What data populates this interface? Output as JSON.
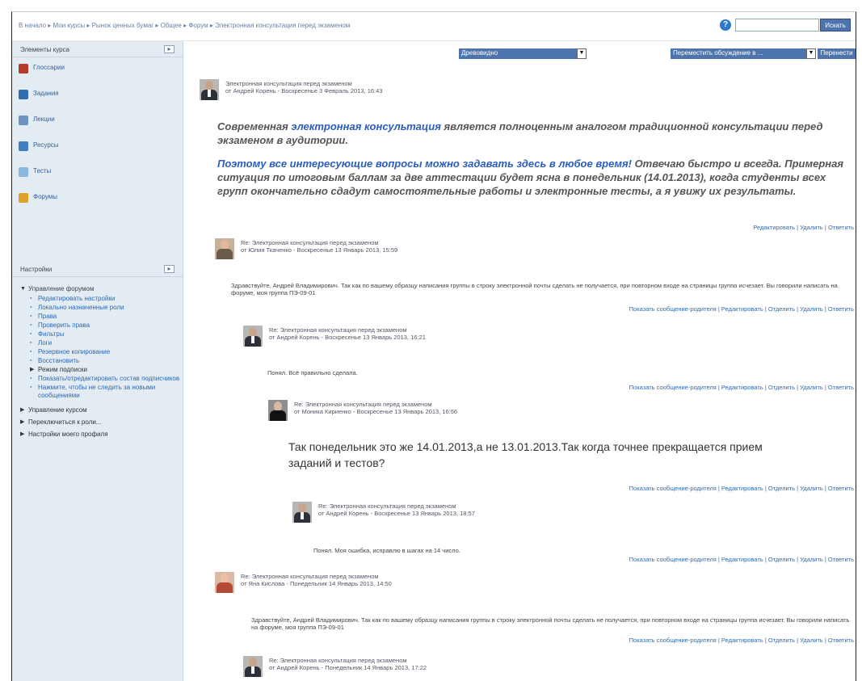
{
  "breadcrumb": "В начало ▸ Мои курсы ▸ Рынок ценных бумаг ▸ Общее ▸ Форум ▸ Электронная консультация перед экзаменом",
  "search": {
    "button": "Искать"
  },
  "controls": {
    "display_mode": "Древовидно",
    "move_select": "Переместить обсуждение в ...",
    "move_button": "Перенести"
  },
  "sidebar": {
    "course_block_title": "Элементы курса",
    "course_items": [
      {
        "label": "Глоссарии",
        "color": "#b23b2a"
      },
      {
        "label": "Задания",
        "color": "#2d6db0"
      },
      {
        "label": "Лекции",
        "color": "#6d94bf"
      },
      {
        "label": "Ресурсы",
        "color": "#3f7fc0"
      },
      {
        "label": "Тесты",
        "color": "#8bb6e0"
      },
      {
        "label": "Форумы",
        "color": "#e0a12b"
      }
    ],
    "settings_title": "Настройки",
    "forum_admin": "Управление форумом",
    "forum_links": [
      "Редактировать настройки",
      "Локально назначенные роли",
      "Права",
      "Проверить права",
      "Фильтры",
      "Логи",
      "Резервное копирование",
      "Восстановить"
    ],
    "subscription_mode": "Режим подписки",
    "forum_links2": [
      "Показать/отредактировать состав подписчиков",
      "Нажмите, чтобы не следить за новыми сообщениями"
    ],
    "course_admin": "Управление курсом",
    "switch_role": "Переключиться к роли...",
    "profile_settings": "Настройки моего профиля"
  },
  "posts": [
    {
      "subject": "Электронная консультация перед экзаменом",
      "author": "от Андрей Корень - Воскресенье 3 Февраль 2013, 16:43",
      "actions": "Редактировать | Удалить | Ответить"
    },
    {
      "subject": "Re: Электронная консультация перед экзаменом",
      "author": "от Юлия Ткаченко - Воскресенье 13 Январь 2013, 15:59",
      "body": "Здравствуйте, Андрей Владимирович. Так как по вашему образцу написания группы в строку электронной почты сделать не получается, при повторном входе на страницы группа исчезает. Вы говорили написать на форуме, моя группа ПЭ-09-01",
      "actions": "Показать сообщение-родителя | Редактировать | Отделить | Удалить | Ответить"
    },
    {
      "subject": "Re: Электронная консультация перед экзаменом",
      "author": "от Андрей Корень - Воскресенье 13 Январь 2013, 16:21",
      "body": "Понял. Всё правильно сделала.",
      "actions": "Показать сообщение-родителя | Редактировать | Отделить | Удалить | Ответить"
    },
    {
      "subject": "Re: Электронная консультация перед экзаменом",
      "author": "от Моника Кириенко - Воскресенье 13 Январь 2013, 16:56",
      "body": "Так понедельник это же 14.01.2013,а не 13.01.2013.Так когда точнее прекращается прием заданий и тестов?",
      "actions": "Показать сообщение-родителя | Редактировать | Отделить | Удалить | Ответить"
    },
    {
      "subject": "Re: Электронная консультация перед экзаменом",
      "author": "от Андрей Корень - Воскресенье 13 Январь 2013, 18:57",
      "body": "Понял. Моя ошибка, исправлю в шагах на 14 число.",
      "actions": "Показать сообщение-родителя | Редактировать | Отделить | Удалить | Ответить"
    },
    {
      "subject": "Re: Электронная консультация перед экзаменом",
      "author": "от Яна Кислова - Понедельник 14 Январь 2013, 14:50",
      "body": "Здравствуйте, Андрей Владимирович. Так как по вашему образцу написания группы в строку электронной почты сделать не получается, при повторном входе на страницы группа исчезает. Вы говорили написать на форуме, моя группа ПЭ-09-01",
      "actions": "Показать сообщение-родителя | Редактировать | Отделить | Удалить | Ответить"
    },
    {
      "subject": "Re: Электронная консультация перед экзаменом",
      "author": "от Андрей Корень - Понедельник 14 Январь 2013, 17:22"
    }
  ],
  "intro": {
    "p1_a": "Современная ",
    "p1_link": "электронная консультация",
    "p1_b": " является полноценным аналогом традиционной консультации перед экзаменом в аудитории.",
    "p2_link": "Поэтому все интересующие вопросы можно задавать здесь в любое время!",
    "p2_b": " Отвечаю быстро и всегда. Примерная ситуация по итоговым баллам за две аттестации будет ясна в понедельник (14.01.2013), когда студенты всех групп окончательно сдадут самостоятельные работы и электронные тесты, а я увижу их результаты."
  }
}
